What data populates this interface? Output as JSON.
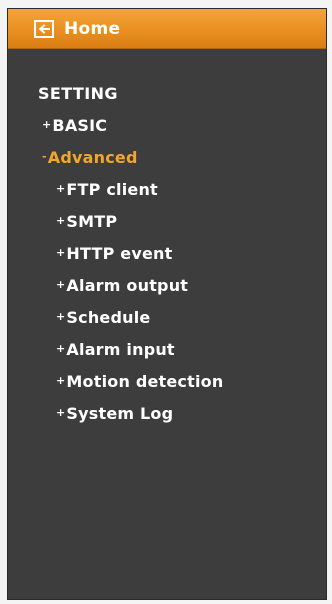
{
  "header": {
    "home_label": "Home",
    "icon": "back-arrow-icon"
  },
  "menu": {
    "section_title": "SETTING",
    "basic": {
      "bullet": "+",
      "label": "BASIC"
    },
    "advanced": {
      "bullet": "-",
      "label": "Advanced"
    },
    "sub_items": [
      {
        "bullet": "+",
        "label": "FTP client"
      },
      {
        "bullet": "+",
        "label": "SMTP"
      },
      {
        "bullet": "+",
        "label": "HTTP event"
      },
      {
        "bullet": "+",
        "label": "Alarm output"
      },
      {
        "bullet": "+",
        "label": "Schedule"
      },
      {
        "bullet": "+",
        "label": "Alarm input"
      },
      {
        "bullet": "+",
        "label": "Motion detection"
      },
      {
        "bullet": "+",
        "label": "System Log"
      }
    ]
  },
  "colors": {
    "header_orange": "#ea8f20",
    "panel_background": "#3d3d3d",
    "active_text": "#f2a62e",
    "text": "#ffffff"
  }
}
